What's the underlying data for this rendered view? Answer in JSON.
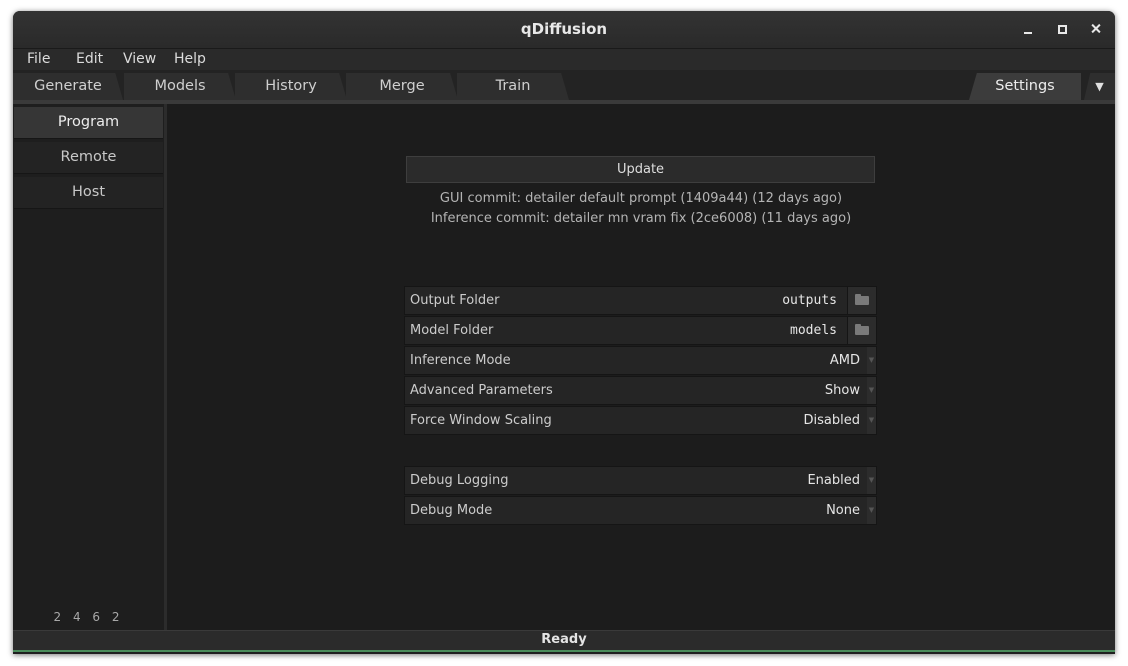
{
  "window": {
    "title": "qDiffusion"
  },
  "menu": [
    "File",
    "Edit",
    "View",
    "Help"
  ],
  "tabs": [
    "Generate",
    "Models",
    "History",
    "Merge",
    "Train",
    "Settings"
  ],
  "active_tab": "Settings",
  "tab_menu_icon": "▼",
  "sidebar": {
    "items": [
      "Program",
      "Remote",
      "Host"
    ],
    "active": "Program",
    "footer": "2 4 6 2"
  },
  "main": {
    "update_label": "Update",
    "gui_commit": "GUI commit: detailer default prompt (1409a44) (12 days ago)",
    "inference_commit": "Inference commit: detailer mn vram fix (2ce6008) (11 days ago)",
    "output_folder": {
      "label": "Output Folder",
      "value": "outputs",
      "icon": "folder-icon"
    },
    "model_folder": {
      "label": "Model Folder",
      "value": "models",
      "icon": "folder-icon"
    },
    "inference_mode": {
      "label": "Inference Mode",
      "value": "AMD"
    },
    "advanced_parameters": {
      "label": "Advanced Parameters",
      "value": "Show"
    },
    "force_window_scaling": {
      "label": "Force Window Scaling",
      "value": "Disabled"
    },
    "debug_logging": {
      "label": "Debug Logging",
      "value": "Enabled"
    },
    "debug_mode": {
      "label": "Debug Mode",
      "value": "None"
    }
  },
  "status": {
    "text": "Ready",
    "progress_fraction": 1.0
  },
  "colors": {
    "background": "#1c1c1c",
    "progress": "#4a8c5a"
  }
}
